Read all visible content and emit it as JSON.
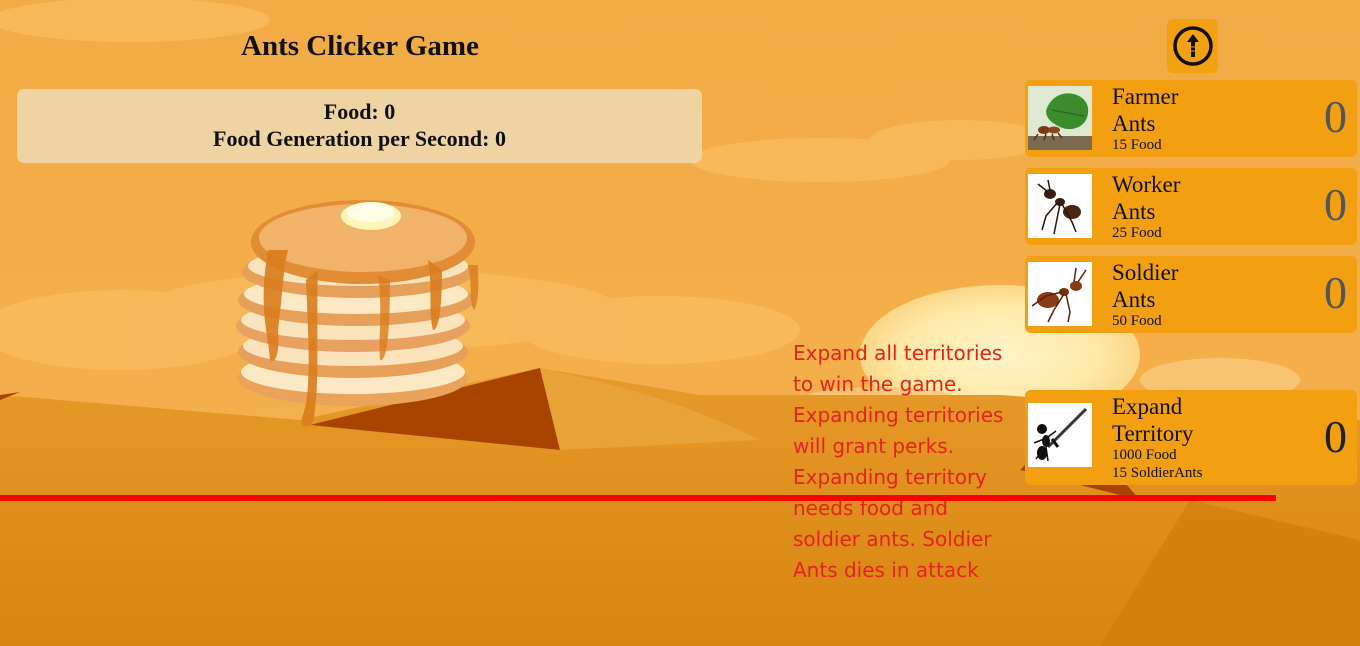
{
  "game": {
    "title": "Ants Clicker Game",
    "food_line": "Food: 0",
    "gen_line": "Food Generation per Second: 0"
  },
  "hint": "Expand all territories to win the game. Expanding territories will grant perks. Expanding territory needs food and soldier ants. Soldier Ants dies in attack",
  "shop": {
    "upgrade_icon": "arrow-up-circle-icon",
    "items": [
      {
        "name_line1": "Farmer",
        "name_line2": "Ants",
        "cost": "15 Food",
        "count": "0"
      },
      {
        "name_line1": "Worker",
        "name_line2": "Ants",
        "cost": "25 Food",
        "count": "0"
      },
      {
        "name_line1": "Soldier",
        "name_line2": "Ants",
        "cost": "50 Food",
        "count": "0"
      }
    ],
    "expand": {
      "name_line1": "Expand",
      "name_line2": "Territory",
      "cost1": "1000 Food",
      "cost2": "15 SoldierAnts",
      "count": "0"
    }
  },
  "colors": {
    "sky": "#f0a73f",
    "dune_dark": "#a94300",
    "card": "#f29f12",
    "hint_text": "#e3241b",
    "line": "#ff0000"
  }
}
